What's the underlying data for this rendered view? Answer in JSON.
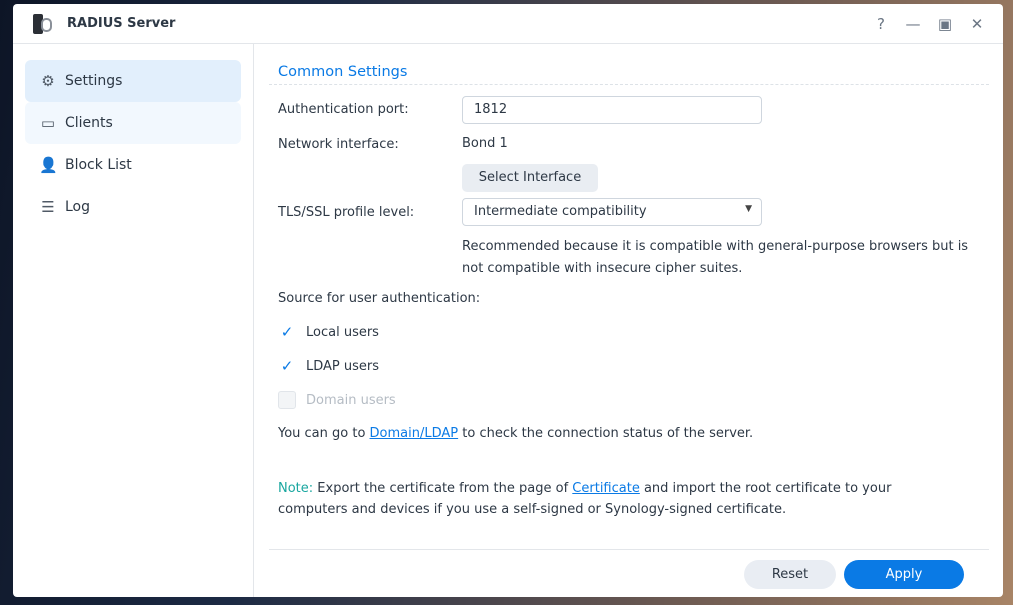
{
  "window": {
    "title": "RADIUS Server",
    "help": "?",
    "minimize": "—",
    "maximize": "▣",
    "close": "✕"
  },
  "sidebar": {
    "items": [
      {
        "label": "Settings",
        "icon": "gear-icon",
        "glyph": "⚙"
      },
      {
        "label": "Clients",
        "icon": "clients-icon",
        "glyph": "▭"
      },
      {
        "label": "Block List",
        "icon": "block-user-icon",
        "glyph": "👤"
      },
      {
        "label": "Log",
        "icon": "log-icon",
        "glyph": "☰"
      }
    ]
  },
  "main": {
    "section_title": "Common Settings",
    "auth_port_label": "Authentication port:",
    "auth_port_value": "1812",
    "network_interface_label": "Network interface:",
    "network_interface_value": "Bond 1",
    "select_interface_button": "Select Interface",
    "tls_label": "TLS/SSL profile level:",
    "tls_value": "Intermediate compatibility",
    "tls_desc": "Recommended because it is compatible with general-purpose browsers but is not compatible with insecure cipher suites.",
    "source_label": "Source for user authentication:",
    "sources": [
      {
        "label": "Local users",
        "checked": true,
        "disabled": false
      },
      {
        "label": "LDAP users",
        "checked": true,
        "disabled": false
      },
      {
        "label": "Domain users",
        "checked": false,
        "disabled": true
      }
    ],
    "domain_text_pre": "You can go to ",
    "domain_link": "Domain/LDAP",
    "domain_text_post": " to check the connection status of the server.",
    "note_label": "Note:",
    "note_pre": " Export the certificate from the page of ",
    "note_link": "Certificate",
    "note_post": " and import the root certificate to your computers and devices if you use a self-signed or Synology-signed certificate."
  },
  "footer": {
    "reset": "Reset",
    "apply": "Apply"
  },
  "colors": {
    "accent": "#0a7ae5",
    "note": "#1aa7a0"
  }
}
